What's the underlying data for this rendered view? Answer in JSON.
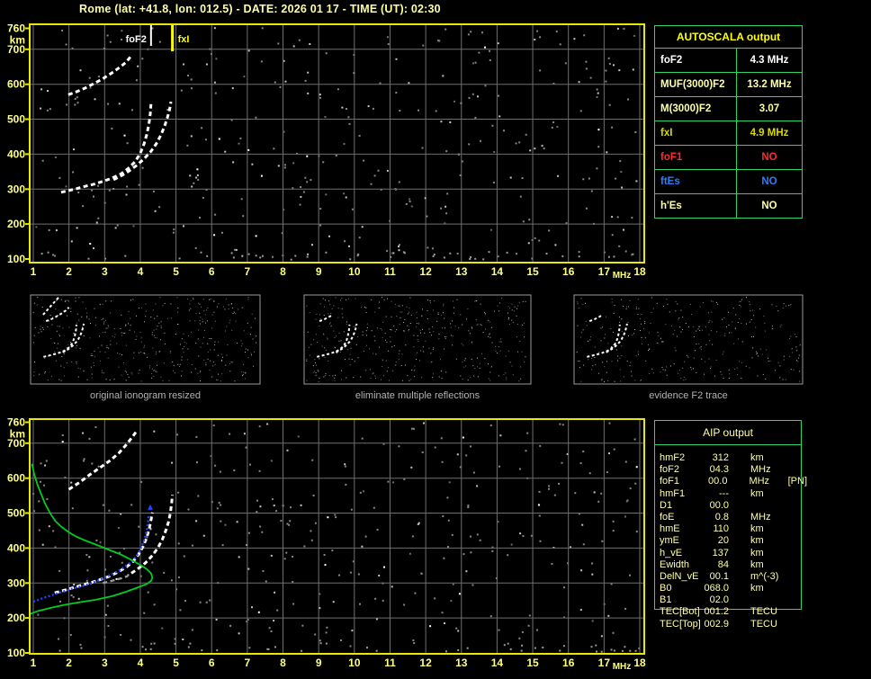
{
  "header": {
    "title": "Rome (lat: +41.8, lon: 012.5) - DATE: 2026 01 17 - TIME (UT): 02:30"
  },
  "colors": {
    "background": "#000000",
    "title_text": "#ffffa8",
    "axis_text": "#ffff80",
    "plot_border": "#e8e800",
    "grid": "#6f6f6f",
    "trace_white": "#ffffff",
    "noise_gray": "#878787",
    "profile_green": "#00cc22",
    "restored_blue": "#2a42ff",
    "table_border": "#2fd465",
    "autoscala_header": "#ffff00",
    "aip_text": "#ffffa6",
    "thumb_border": "#9a9a9a",
    "caption_text": "#b2b2b2"
  },
  "autoscala": {
    "title": "AUTOSCALA output",
    "rows": [
      {
        "label": "foF2",
        "value": "4.3 MHz",
        "color": "#ffffff"
      },
      {
        "label": "MUF(3000)F2",
        "value": "13.2 MHz",
        "color": "#ffffa6"
      },
      {
        "label": "M(3000)F2",
        "value": "3.07",
        "color": "#ffffa6"
      },
      {
        "label": "fxI",
        "value": "4.9 MHz",
        "color": "#d9d900"
      },
      {
        "label": "foF1",
        "value": "NO",
        "color": "#ff2a2a"
      },
      {
        "label": "ftEs",
        "value": "NO",
        "color": "#2a7fff"
      },
      {
        "label": "h'Es",
        "value": "NO",
        "color": "#ffffa6"
      }
    ]
  },
  "aip": {
    "title": "AIP output",
    "rows": [
      {
        "label": "hmF2",
        "value": "312",
        "unit": "km",
        "extra": ""
      },
      {
        "label": "foF2",
        "value": "04.3",
        "unit": "MHz",
        "extra": ""
      },
      {
        "label": "foF1",
        "value": "00.0",
        "unit": "MHz",
        "extra": "[PN]"
      },
      {
        "label": "hmF1",
        "value": "---",
        "unit": "km",
        "extra": ""
      },
      {
        "label": "D1",
        "value": "00.0",
        "unit": "",
        "extra": ""
      },
      {
        "label": "foE",
        "value": "0.8",
        "unit": "MHz",
        "extra": ""
      },
      {
        "label": "hmE",
        "value": "110",
        "unit": "km",
        "extra": ""
      },
      {
        "label": "ymE",
        "value": "20",
        "unit": "km",
        "extra": ""
      },
      {
        "label": "h_vE",
        "value": "137",
        "unit": "km",
        "extra": ""
      },
      {
        "label": "Ewidth",
        "value": "84",
        "unit": "km",
        "extra": ""
      },
      {
        "label": "DelN_vE",
        "value": "00.1",
        "unit": "m^(-3)",
        "extra": ""
      },
      {
        "label": "B0",
        "value": "068.0",
        "unit": "km",
        "extra": ""
      },
      {
        "label": "B1",
        "value": "02.0",
        "unit": "",
        "extra": ""
      },
      {
        "label": "TEC[Bot]",
        "value": "001.2",
        "unit": "TECU",
        "extra": ""
      },
      {
        "label": "TEC[Top]",
        "value": "002.9",
        "unit": "TECU",
        "extra": ""
      }
    ]
  },
  "thumbnails": [
    {
      "caption": "original ionogram resized"
    },
    {
      "caption": "eliminate multiple reflections"
    },
    {
      "caption": "evidence F2 trace"
    }
  ],
  "chart_data": [
    {
      "id": "top-ionogram",
      "type": "scatter",
      "title": "recorded ionogram with scaled foF2 and fxI markers",
      "xlabel": "MHz",
      "ylabel": "km",
      "xlim": [
        1,
        18
      ],
      "ylim": [
        100,
        760
      ],
      "grid": true,
      "xticks": [
        1,
        2,
        3,
        4,
        5,
        6,
        7,
        8,
        9,
        10,
        11,
        12,
        13,
        14,
        15,
        16,
        17,
        18
      ],
      "yticks": [
        100,
        200,
        300,
        400,
        500,
        600,
        700,
        760
      ],
      "markers": [
        {
          "label": "foF2",
          "mhz": 4.3,
          "color": "#ffffff",
          "side": "left"
        },
        {
          "label": "fxI",
          "mhz": 4.9,
          "color": "#ffff00",
          "side": "right"
        }
      ],
      "series": [
        {
          "name": "F2 O-mode trace",
          "color": "#ffffff",
          "points": [
            [
              1.78,
              291
            ],
            [
              2.0,
              296
            ],
            [
              2.2,
              301
            ],
            [
              2.45,
              308
            ],
            [
              2.7,
              314
            ],
            [
              2.95,
              322
            ],
            [
              3.2,
              331
            ],
            [
              3.45,
              343
            ],
            [
              3.65,
              358
            ],
            [
              3.85,
              378
            ],
            [
              4.0,
              402
            ],
            [
              4.1,
              428
            ],
            [
              4.18,
              456
            ],
            [
              4.24,
              486
            ],
            [
              4.28,
              515
            ],
            [
              4.3,
              543
            ]
          ]
        },
        {
          "name": "F2 X-mode trace",
          "color": "#ffffff",
          "points": [
            [
              3.25,
              327
            ],
            [
              3.5,
              340
            ],
            [
              3.7,
              353
            ],
            [
              3.9,
              368
            ],
            [
              4.1,
              386
            ],
            [
              4.3,
              408
            ],
            [
              4.45,
              430
            ],
            [
              4.58,
              455
            ],
            [
              4.68,
              480
            ],
            [
              4.76,
              505
            ],
            [
              4.82,
              528
            ],
            [
              4.86,
              550
            ]
          ]
        },
        {
          "name": "second hop trace",
          "color": "#ffffff",
          "points": [
            [
              1.98,
              570
            ],
            [
              2.2,
              578
            ],
            [
              2.45,
              589
            ],
            [
              2.7,
              602
            ],
            [
              2.95,
              616
            ],
            [
              3.2,
              632
            ],
            [
              3.42,
              648
            ],
            [
              3.6,
              663
            ],
            [
              3.72,
              678
            ]
          ]
        }
      ]
    },
    {
      "id": "bottom-ionogram",
      "type": "scatter",
      "title": "ionogram with restored trace and electron density profile",
      "xlabel": "MHz",
      "ylabel": "km",
      "xlim": [
        1,
        18
      ],
      "ylim": [
        100,
        760
      ],
      "grid": true,
      "xticks": [
        1,
        2,
        3,
        4,
        5,
        6,
        7,
        8,
        9,
        10,
        11,
        12,
        13,
        14,
        15,
        16,
        17,
        18
      ],
      "yticks": [
        100,
        200,
        300,
        400,
        500,
        600,
        700,
        760
      ],
      "markers": [],
      "series": [
        {
          "name": "F2 O-mode trace",
          "color": "#ffffff",
          "points": [
            [
              1.6,
              272
            ],
            [
              1.9,
              280
            ],
            [
              2.2,
              289
            ],
            [
              2.5,
              298
            ],
            [
              2.8,
              307
            ],
            [
              3.1,
              318
            ],
            [
              3.35,
              330
            ],
            [
              3.6,
              345
            ],
            [
              3.8,
              362
            ],
            [
              3.95,
              382
            ],
            [
              4.08,
              405
            ],
            [
              4.18,
              430
            ],
            [
              4.25,
              455
            ],
            [
              4.3,
              480
            ],
            [
              4.34,
              502
            ]
          ]
        },
        {
          "name": "F2 X-mode trace",
          "color": "#ffffff",
          "points": [
            [
              3.75,
              328
            ],
            [
              3.95,
              342
            ],
            [
              4.15,
              358
            ],
            [
              4.35,
              380
            ],
            [
              4.5,
              402
            ],
            [
              4.62,
              425
            ],
            [
              4.72,
              452
            ],
            [
              4.8,
              478
            ],
            [
              4.85,
              505
            ],
            [
              4.88,
              530
            ],
            [
              4.9,
              552
            ]
          ]
        },
        {
          "name": "second hop trace",
          "color": "#ffffff",
          "points": [
            [
              2.0,
              568
            ],
            [
              2.3,
              588
            ],
            [
              2.6,
              611
            ],
            [
              2.9,
              632
            ],
            [
              3.15,
              650
            ],
            [
              3.4,
              672
            ],
            [
              3.6,
              695
            ],
            [
              3.78,
              718
            ],
            [
              3.92,
              738
            ]
          ]
        },
        {
          "name": "echo segment",
          "color": "#9a9a9a",
          "width": 2.4,
          "points": [
            [
              2.95,
              300
            ],
            [
              3.2,
              306
            ],
            [
              3.45,
              313
            ],
            [
              3.65,
              320
            ]
          ]
        },
        {
          "name": "restored O-trace",
          "color": "#2a42ff",
          "style": "dots",
          "points": [
            [
              1.0,
              247
            ],
            [
              1.15,
              252
            ],
            [
              1.33,
              259
            ],
            [
              1.55,
              266
            ],
            [
              1.75,
              273
            ],
            [
              1.95,
              279
            ],
            [
              2.17,
              286
            ],
            [
              2.4,
              292
            ],
            [
              2.6,
              298
            ],
            [
              2.8,
              306
            ],
            [
              3.0,
              315
            ],
            [
              3.2,
              325
            ],
            [
              3.43,
              337
            ],
            [
              3.6,
              349
            ],
            [
              3.77,
              363
            ],
            [
              3.9,
              378
            ],
            [
              3.99,
              394
            ],
            [
              4.07,
              412
            ],
            [
              4.13,
              430
            ],
            [
              4.18,
              450
            ],
            [
              4.21,
              470
            ],
            [
              4.23,
              492
            ]
          ]
        },
        {
          "name": "restored isolated point",
          "color": "#2a42ff",
          "style": "point",
          "points": [
            [
              4.28,
              517
            ]
          ]
        },
        {
          "name": "electron density profile",
          "color": "#00cc22",
          "style": "line",
          "points": [
            [
              0.96,
              641
            ],
            [
              1.03,
              610
            ],
            [
              1.12,
              580
            ],
            [
              1.22,
              555
            ],
            [
              1.33,
              527
            ],
            [
              1.47,
              500
            ],
            [
              1.62,
              477
            ],
            [
              1.8,
              460
            ],
            [
              2.0,
              445
            ],
            [
              2.2,
              433
            ],
            [
              2.45,
              422
            ],
            [
              2.75,
              410
            ],
            [
              3.1,
              396
            ],
            [
              3.45,
              382
            ],
            [
              3.75,
              366
            ],
            [
              4.0,
              352
            ],
            [
              4.18,
              340
            ],
            [
              4.3,
              328
            ],
            [
              4.34,
              316
            ],
            [
              4.3,
              306
            ],
            [
              4.18,
              297
            ],
            [
              3.95,
              288
            ],
            [
              3.6,
              275
            ],
            [
              3.2,
              262
            ],
            [
              2.75,
              252
            ],
            [
              2.3,
              245
            ],
            [
              1.85,
              237
            ],
            [
              1.45,
              228
            ],
            [
              1.1,
              219
            ],
            [
              0.92,
              212
            ]
          ]
        }
      ]
    }
  ]
}
